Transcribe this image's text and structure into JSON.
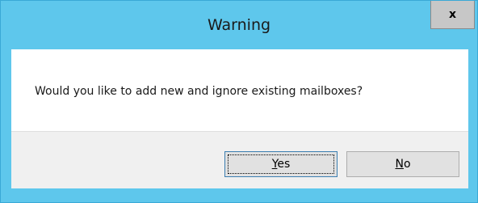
{
  "window": {
    "title": "Warning",
    "close_glyph": "x",
    "close_icon": "close-icon"
  },
  "message": "Would you like to add new and ignore existing mailboxes?",
  "buttons": {
    "yes": {
      "accel": "Y",
      "rest": "es"
    },
    "no": {
      "accel": "N",
      "rest": "o"
    }
  },
  "colors": {
    "frame": "#5ec7ec",
    "content_bg": "#ffffff",
    "button_area_bg": "#f0f0f0",
    "button_bg": "#e1e1e1",
    "close_bg": "#c7c7c7"
  }
}
